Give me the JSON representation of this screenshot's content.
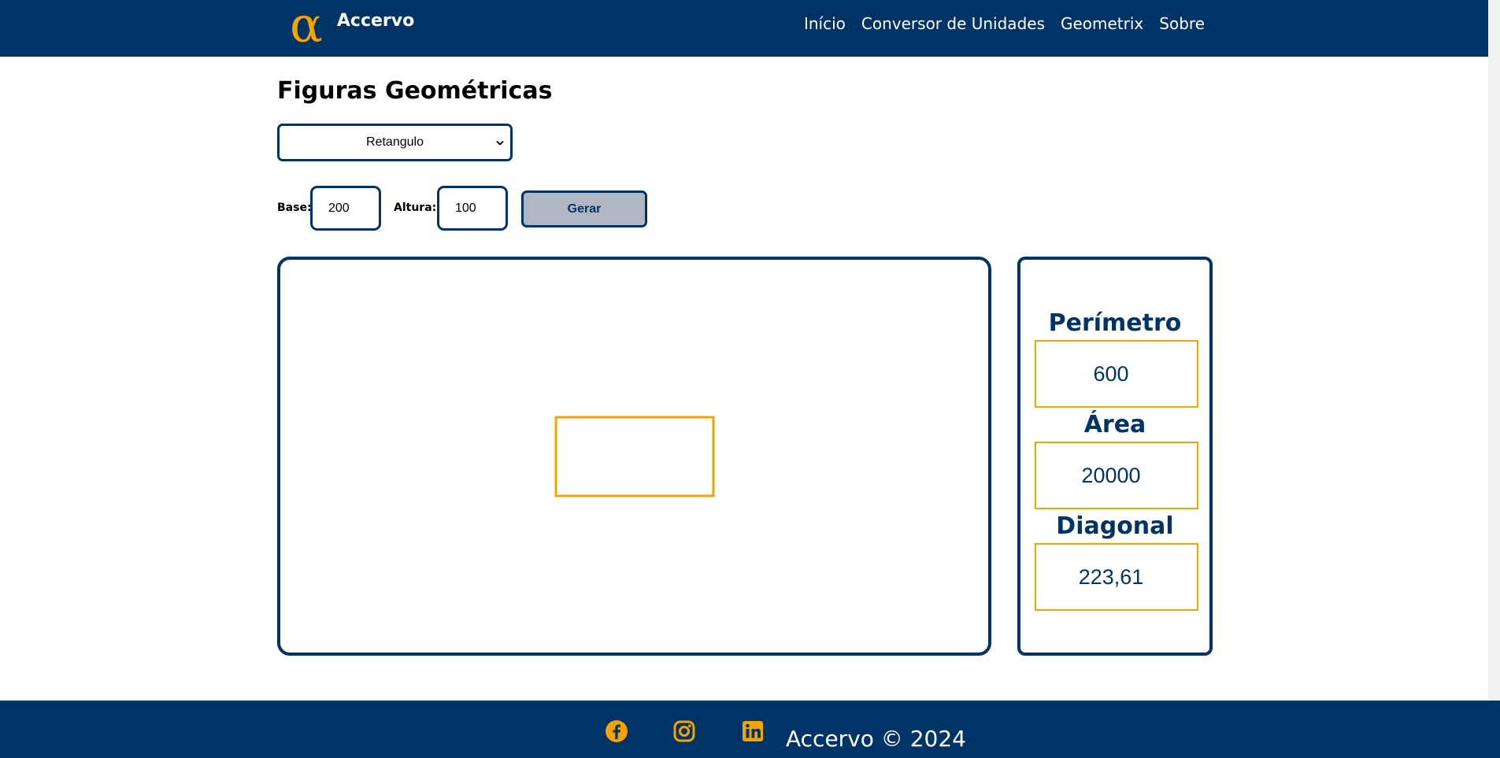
{
  "header": {
    "logo_glyph": "α",
    "brand": "Accervo",
    "nav": [
      "Início",
      "Conversor de Unidades",
      "Geometrix",
      "Sobre"
    ]
  },
  "main": {
    "title": "Figuras Geométricas",
    "shape_select": {
      "value": "Retangulo"
    },
    "base_label": "Base:",
    "base_value": "200",
    "altura_label": "Altura:",
    "altura_value": "100",
    "generate_button": "Gerar"
  },
  "results": {
    "perimeter_label": "Perímetro",
    "perimeter_value": "600",
    "area_label": "Área",
    "area_value": "20000",
    "diagonal_label": "Diagonal",
    "diagonal_value": "223,61"
  },
  "footer": {
    "icons": [
      "facebook-icon",
      "instagram-icon",
      "linkedin-icon"
    ],
    "text": "Accervo © 2024"
  },
  "colors": {
    "primary": "#003366",
    "accent": "#f5a300",
    "button_bg": "#b1b7c2"
  }
}
